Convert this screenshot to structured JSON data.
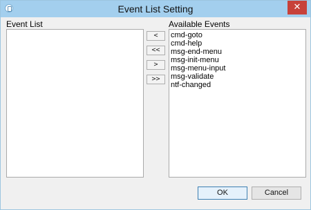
{
  "window": {
    "title": "Event List Setting",
    "close_glyph": "✕"
  },
  "event_list": {
    "label": "Event List",
    "items": []
  },
  "available_events": {
    "label": "Available Events",
    "items": [
      "cmd-goto",
      "cmd-help",
      "msg-end-menu",
      "msg-init-menu",
      "msg-menu-input",
      "msg-validate",
      "ntf-changed"
    ]
  },
  "move_buttons": {
    "add_one": "<",
    "add_all": "<<",
    "remove_one": ">",
    "remove_all": ">>"
  },
  "footer": {
    "ok": "OK",
    "cancel": "Cancel"
  },
  "colors": {
    "titlebar": "#a3cfee",
    "close_button": "#c7413a",
    "window_bg": "#f0f0f0"
  }
}
